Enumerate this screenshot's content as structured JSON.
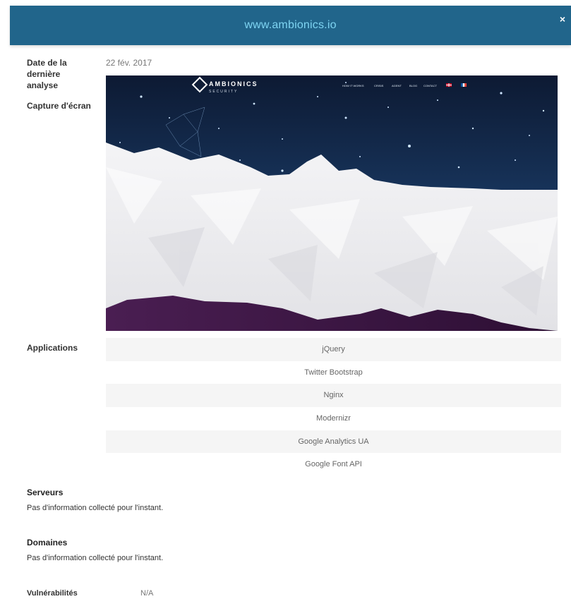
{
  "header": {
    "title": "www.ambionics.io",
    "close_label": "×"
  },
  "details": {
    "last_scan_label_line1": "Date de la",
    "last_scan_label_line2": "dernière",
    "last_scan_label_line3": "analyse",
    "last_scan_value": "22 fév. 2017",
    "screenshot_label": "Capture d'écran"
  },
  "screenshot": {
    "logo_top": "AMBIONICS",
    "logo_bottom": "SECURITY",
    "nav": [
      "HOW IT WORKS",
      "CRISIS",
      "AGENT",
      "BLOG",
      "CONTACT"
    ]
  },
  "applications": {
    "label": "Applications",
    "items": [
      "jQuery",
      "Twitter Bootstrap",
      "Nginx",
      "Modernizr",
      "Google Analytics UA",
      "Google Font API"
    ]
  },
  "servers": {
    "title": "Serveurs",
    "text": "Pas d'information collecté pour l'instant."
  },
  "domains": {
    "title": "Domaines",
    "text": "Pas d'information collecté pour l'instant."
  },
  "vulnerabilities": {
    "label": "Vulnérabilités",
    "value": "N/A"
  },
  "colors": {
    "header_bg": "#21658b",
    "header_title": "#7ed4f2",
    "row_alt": "#f5f5f5"
  }
}
